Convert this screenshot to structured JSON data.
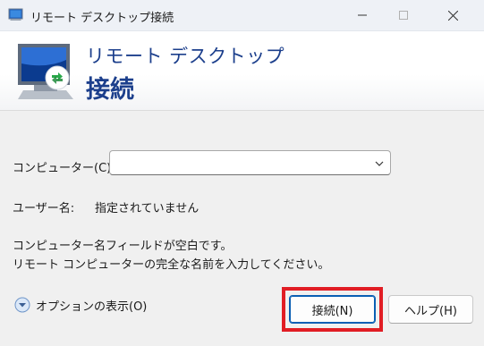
{
  "window": {
    "title": "リモート デスクトップ接続",
    "controls": [
      "minimize",
      "maximize",
      "close"
    ]
  },
  "banner": {
    "line1": "リモート デスクトップ",
    "line2": "接続",
    "icon": "remote-desktop-monitor-icon"
  },
  "form": {
    "computer_label": "コンピューター(C):",
    "computer_value": "",
    "username_label": "ユーザー名:",
    "username_value": "指定されていません",
    "message_line1": "コンピューター名フィールドが空白です。",
    "message_line2": "リモート コンピューターの完全な名前を入力してください。"
  },
  "options": {
    "label": "オプションの表示(O)",
    "icon": "expand-down-icon"
  },
  "buttons": {
    "connect": "接続(N)",
    "help": "ヘルプ(H)"
  },
  "colors": {
    "banner_text": "#1c3f8c",
    "highlight": "#e11d24",
    "default_button_border": "#0a5fb4"
  }
}
